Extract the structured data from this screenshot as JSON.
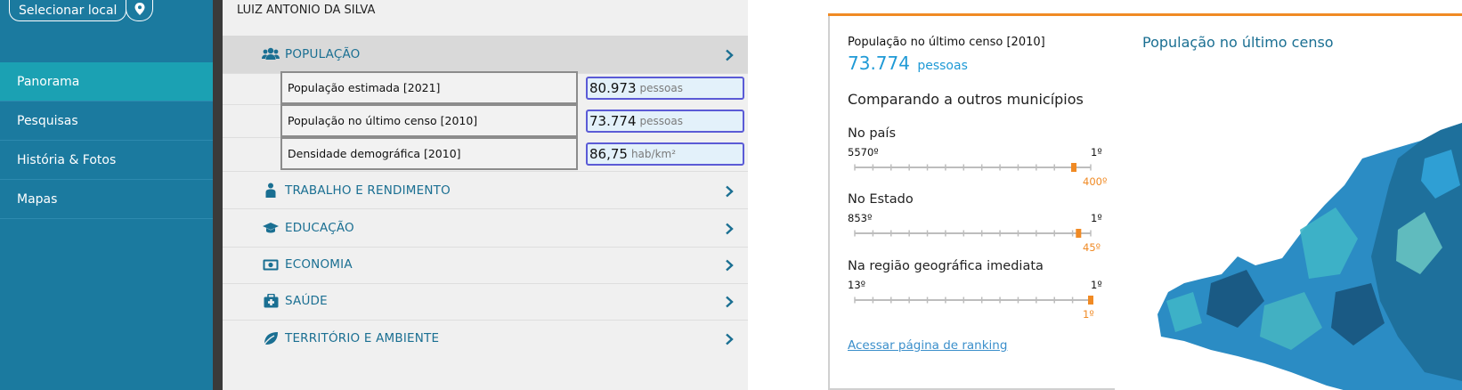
{
  "sidebar": {
    "select_local_label": "Selecionar local",
    "pin_icon": "map-pin-icon",
    "nav": [
      {
        "label": "Panorama",
        "active": true
      },
      {
        "label": "Pesquisas",
        "active": false
      },
      {
        "label": "História & Fotos",
        "active": false
      },
      {
        "label": "Mapas",
        "active": false
      }
    ]
  },
  "middle": {
    "person_name": "LUIZ ANTONIO DA SILVA",
    "sections": [
      {
        "label": "POPULAÇÃO",
        "icon": "people-icon",
        "open": true
      },
      {
        "label": "TRABALHO E RENDIMENTO",
        "icon": "worker-icon",
        "open": false
      },
      {
        "label": "EDUCAÇÃO",
        "icon": "graduation-cap-icon",
        "open": false
      },
      {
        "label": "ECONOMIA",
        "icon": "money-icon",
        "open": false
      },
      {
        "label": "SAÚDE",
        "icon": "medkit-icon",
        "open": false
      },
      {
        "label": "TERRITÓRIO E AMBIENTE",
        "icon": "leaf-icon",
        "open": false
      }
    ],
    "population_rows": [
      {
        "label": "População estimada [2021]",
        "value": "80.973",
        "unit": "pessoas"
      },
      {
        "label": "População no último censo [2010]",
        "value": "73.774",
        "unit": "pessoas"
      },
      {
        "label": "Densidade demográfica [2010]",
        "value": "86,75",
        "unit": "hab/km²"
      }
    ]
  },
  "card": {
    "caption": "População no último censo [2010]",
    "value": "73.774",
    "unit": "pessoas",
    "compare_title": "Comparando a outros municípios",
    "rankings": [
      {
        "title": "No país",
        "min": "5570º",
        "max": "1º",
        "position": "400º",
        "position_fraction": 0.9284
      },
      {
        "title": "No Estado",
        "min": "853º",
        "max": "1º",
        "position": "45º",
        "position_fraction": 0.9484
      },
      {
        "title": "Na região geográfica imediata",
        "min": "13º",
        "max": "1º",
        "position": "1º",
        "position_fraction": 1.0
      }
    ],
    "link_text": "Acessar página de ranking",
    "map_title": "População no último censo"
  },
  "colors": {
    "sidebar": "#1b7a9f",
    "sidebar_active": "#1ba1b3",
    "accent": "#f08a24",
    "heading_blue": "#1a6f92",
    "value_blue": "#1f9ad6"
  }
}
